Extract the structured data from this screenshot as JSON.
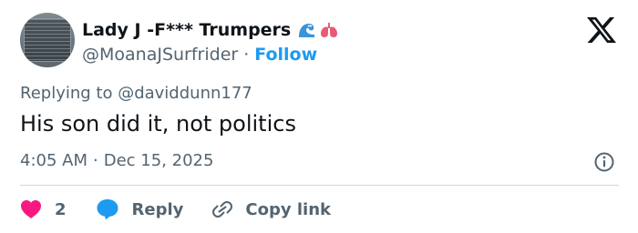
{
  "author": {
    "display_name": "Lady J -F*** Trumpers",
    "emojis": [
      "wave-emoji",
      "lungs-emoji"
    ],
    "handle": "@MoanaJSurfrider",
    "separator": "·",
    "follow_label": "Follow"
  },
  "tweet": {
    "replying_to": "Replying to @daviddunn177",
    "text": "His son did it, not politics",
    "time": "4:05 AM",
    "separator": "·",
    "date": "Dec 15, 2025"
  },
  "actions": {
    "like_count": "2",
    "reply_label": "Reply",
    "copy_label": "Copy link"
  },
  "icons": {
    "brand_logo": "x-logo-icon",
    "info": "info-icon",
    "like": "heart-icon",
    "reply": "speech-bubble-icon",
    "copy": "link-icon"
  },
  "colors": {
    "like": "#f91880",
    "reply": "#1d9bf0",
    "follow": "#1d9bf0",
    "secondary_text": "#536471",
    "primary_text": "#0f1419"
  }
}
